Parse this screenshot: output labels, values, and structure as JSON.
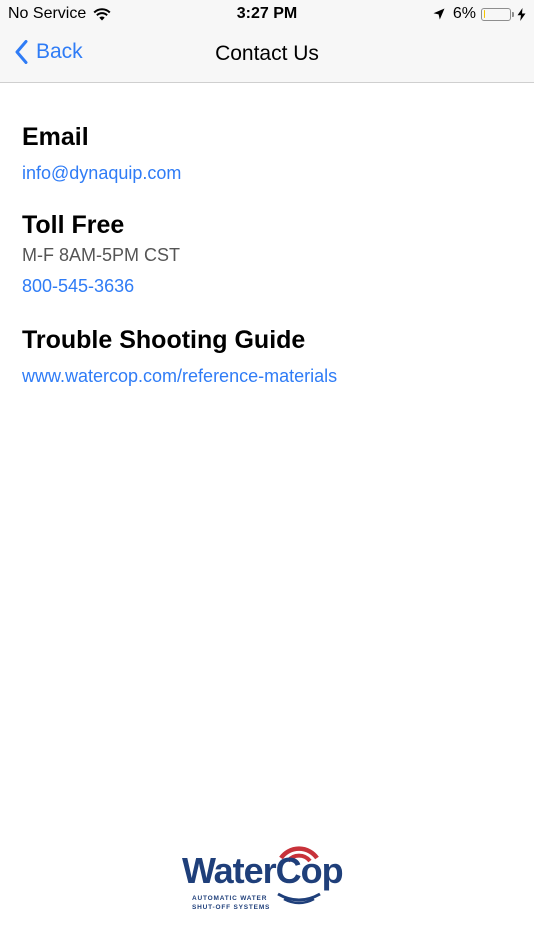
{
  "status_bar": {
    "carrier": "No Service",
    "time": "3:27 PM",
    "battery_percent": "6%",
    "battery_level": 0.06,
    "icons": [
      "wifi-icon",
      "location-arrow-icon",
      "battery-icon",
      "charging-bolt-icon"
    ]
  },
  "nav": {
    "back_label": "Back",
    "title": "Contact Us"
  },
  "contact": {
    "email": {
      "heading": "Email",
      "address": "info@dynaquip.com"
    },
    "toll_free": {
      "heading": "Toll Free",
      "hours": "M-F 8AM-5PM CST",
      "phone": "800-545-3636"
    },
    "guide": {
      "heading": "Trouble Shooting Guide",
      "url": "www.watercop.com/reference-materials"
    }
  },
  "logo": {
    "name": "WaterCop",
    "tagline_line1": "AUTOMATIC WATER",
    "tagline_line2": "SHUT-OFF SYSTEMS"
  },
  "colors": {
    "accent": "#2f7cf6",
    "bar_background": "#f7f7f7",
    "logo_blue": "#1f3f7a",
    "logo_red": "#c8323a",
    "battery_low": "#f5c400"
  }
}
